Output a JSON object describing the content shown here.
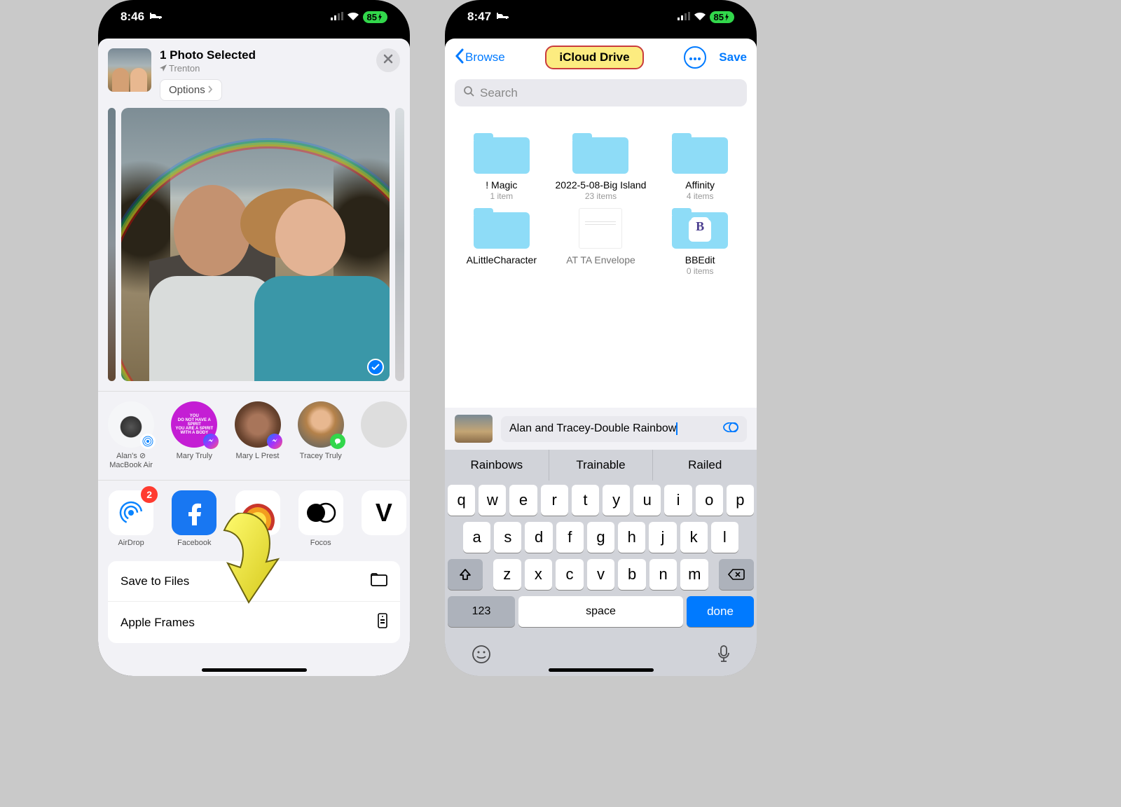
{
  "phone1": {
    "status": {
      "time": "8:46",
      "battery": "85",
      "battery_charging": true
    },
    "sheet": {
      "title": "1 Photo Selected",
      "location": "Trenton",
      "options": "Options"
    },
    "contacts": [
      {
        "name": "Alan's ⊘ MacBook Air",
        "type": "device"
      },
      {
        "name": "Mary Truly",
        "type": "messenger"
      },
      {
        "name": "Mary L Prest",
        "type": "messenger"
      },
      {
        "name": "Tracey Truly",
        "type": "imessage"
      }
    ],
    "apps": [
      {
        "name": "AirDrop",
        "badge": "2"
      },
      {
        "name": "Facebook"
      },
      {
        "name": ""
      },
      {
        "name": "Focos"
      }
    ],
    "actions": [
      {
        "label": "Save to Files",
        "icon": "folder"
      },
      {
        "label": "Apple Frames",
        "icon": "remote"
      }
    ]
  },
  "phone2": {
    "status": {
      "time": "8:47",
      "battery": "85"
    },
    "header": {
      "back": "Browse",
      "title": "iCloud Drive",
      "save": "Save"
    },
    "search_placeholder": "Search",
    "folders": [
      {
        "name": "! Magic",
        "meta": "1 item",
        "type": "folder"
      },
      {
        "name": "2022-5-08-Big Island",
        "meta": "23 items",
        "type": "folder"
      },
      {
        "name": "Affinity",
        "meta": "4 items",
        "type": "folder"
      },
      {
        "name": "ALittleCharacter",
        "meta": "",
        "type": "folder"
      },
      {
        "name": "AT TA Envelope",
        "meta": "",
        "type": "doc"
      },
      {
        "name": "BBEdit",
        "meta": "0 items",
        "type": "bbedit"
      }
    ],
    "rename_value": "Alan and Tracey-Double Rainbow",
    "suggestions": [
      "Rainbows",
      "Trainable",
      "Railed"
    ],
    "keyboard": {
      "r1": [
        "q",
        "w",
        "e",
        "r",
        "t",
        "y",
        "u",
        "i",
        "o",
        "p"
      ],
      "r2": [
        "a",
        "s",
        "d",
        "f",
        "g",
        "h",
        "j",
        "k",
        "l"
      ],
      "r3": [
        "z",
        "x",
        "c",
        "v",
        "b",
        "n",
        "m"
      ],
      "num": "123",
      "space": "space",
      "done": "done"
    }
  }
}
